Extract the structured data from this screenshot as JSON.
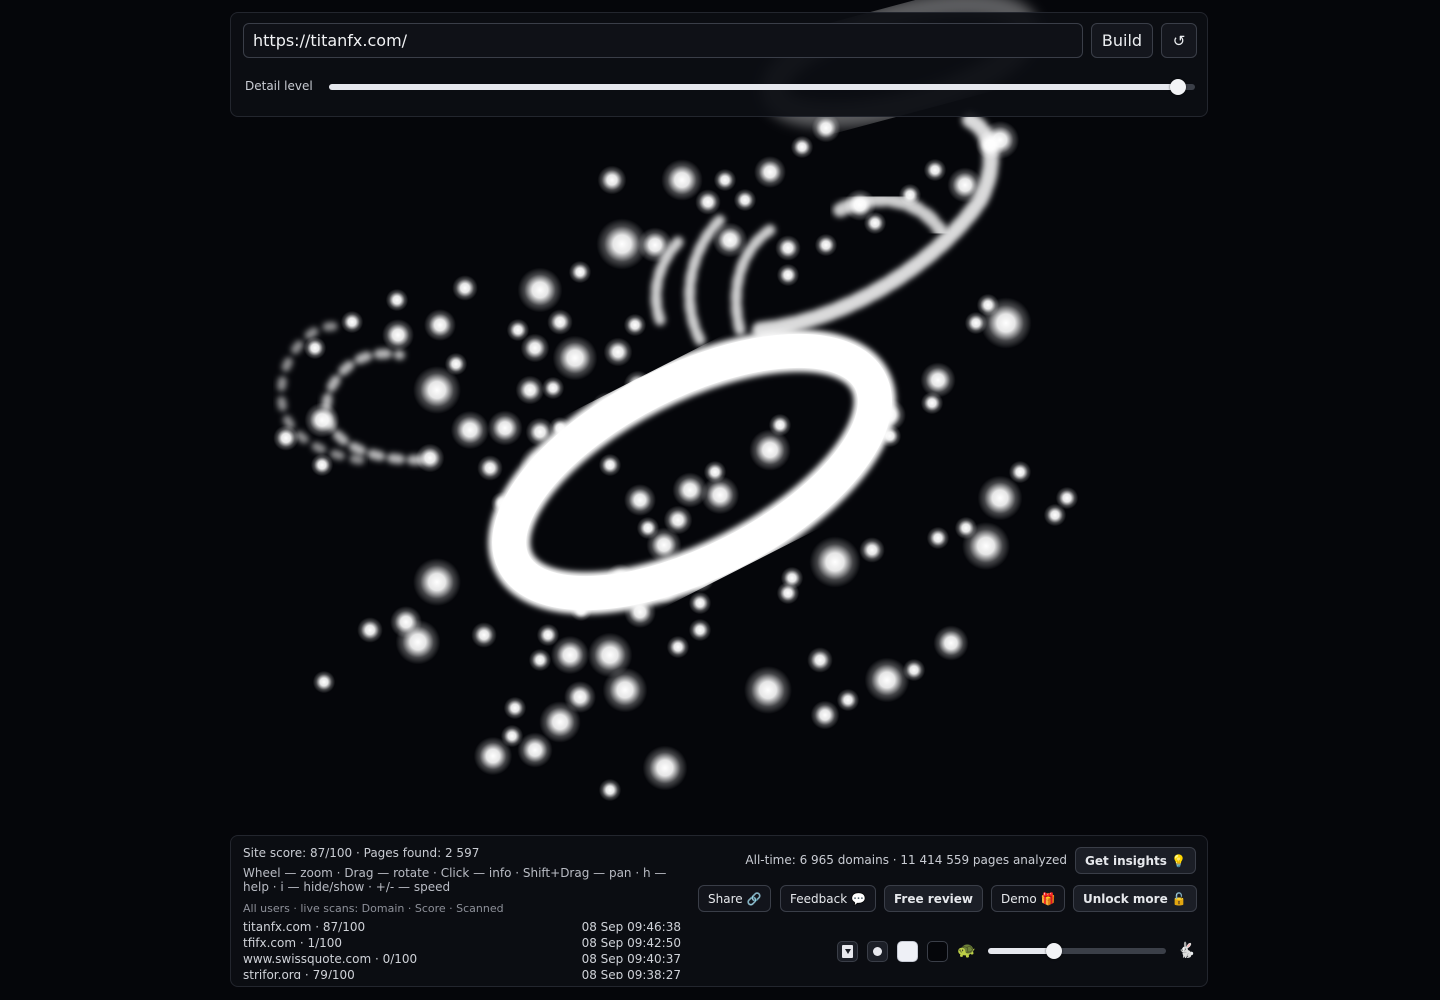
{
  "url_bar": {
    "value": "https://titanfx.com/",
    "build_label": "Build",
    "reset_label": "↺"
  },
  "detail": {
    "label": "Detail level",
    "value_fraction": 0.98
  },
  "stats": {
    "summary": "Site score: 87/100 · Pages found: 2 597",
    "help": "Wheel — zoom · Drag — rotate · Click — info · Shift+Drag — pan · h — help · i — hide/show · +/- — speed",
    "scans_header": "All users · live scans: Domain · Score · Scanned",
    "scans": [
      {
        "domain_score": "titanfx.com · 87/100",
        "scanned": "08 Sep 09:46:38"
      },
      {
        "domain_score": "tfifx.com · 1/100",
        "scanned": "08 Sep 09:42:50"
      },
      {
        "domain_score": "www.swissquote.com · 0/100",
        "scanned": "08 Sep 09:40:37"
      },
      {
        "domain_score": "strifor.org · 79/100",
        "scanned": "08 Sep 09:38:27"
      }
    ]
  },
  "alltime": "All-time: 6 965 domains · 11 414 559 pages analyzed",
  "actions": {
    "insights": "Get insights 💡",
    "share": "Share 🔗",
    "feedback": "Feedback 💬",
    "review": "Free review",
    "demo": "Demo 🎁",
    "unlock": "Unlock more 🔓"
  },
  "controls": {
    "slow_icon": "🐢",
    "fast_icon": "🐇",
    "speed_fraction": 0.37
  },
  "colors": {
    "background": "#05060a",
    "glow": "#ffffff",
    "panel": "#0c0e14"
  }
}
